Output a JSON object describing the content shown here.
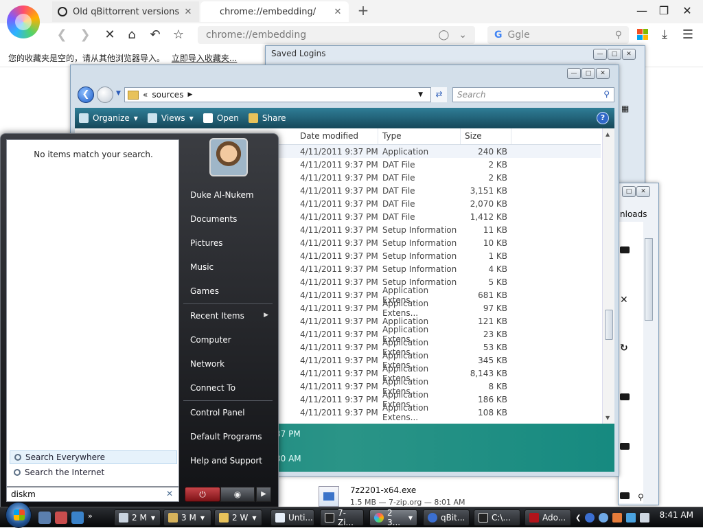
{
  "browser": {
    "tabs": [
      {
        "title": "Old qBittorrent versions down",
        "close": "✕"
      },
      {
        "title": "chrome://embedding/",
        "close": "✕"
      }
    ],
    "new_tab": "+",
    "address": "chrome://embedding",
    "search_engine": "G",
    "search_text": "Ggle",
    "bookmarks_message": "您的收藏夹是空的，请从其他浏览器导入。",
    "bookmarks_link": "立即导入收藏夹..."
  },
  "saved_logins": {
    "title": "Saved Logins"
  },
  "downloads": {
    "title_fragment": "nloads",
    "entry": {
      "name": "7z2201-x64.exe",
      "meta": "1.5 MB — 7-zip.org — 8:01 AM"
    }
  },
  "explorer": {
    "path": {
      "prefix": "«",
      "folder": "sources"
    },
    "search_placeholder": "Search",
    "commands": [
      "Organize",
      "Views",
      "Open",
      "Share"
    ],
    "columns": [
      "Date modified",
      "Type",
      "Size"
    ],
    "rows": [
      {
        "date": "4/11/2011 9:37 PM",
        "type": "Application",
        "size": "240 KB"
      },
      {
        "date": "4/11/2011 9:37 PM",
        "type": "DAT File",
        "size": "2 KB"
      },
      {
        "date": "4/11/2011 9:37 PM",
        "type": "DAT File",
        "size": "2 KB"
      },
      {
        "date": "4/11/2011 9:37 PM",
        "type": "DAT File",
        "size": "3,151 KB"
      },
      {
        "date": "4/11/2011 9:37 PM",
        "type": "DAT File",
        "size": "2,070 KB"
      },
      {
        "date": "4/11/2011 9:37 PM",
        "type": "DAT File",
        "size": "1,412 KB"
      },
      {
        "date": "4/11/2011 9:37 PM",
        "type": "Setup Information",
        "size": "11 KB"
      },
      {
        "date": "4/11/2011 9:37 PM",
        "type": "Setup Information",
        "size": "10 KB"
      },
      {
        "date": "4/11/2011 9:37 PM",
        "type": "Setup Information",
        "size": "1 KB"
      },
      {
        "date": "4/11/2011 9:37 PM",
        "type": "Setup Information",
        "size": "4 KB"
      },
      {
        "date": "4/11/2011 9:37 PM",
        "type": "Setup Information",
        "size": "5 KB"
      },
      {
        "date": "4/11/2011 9:37 PM",
        "type": "Application Extens...",
        "size": "681 KB"
      },
      {
        "date": "4/11/2011 9:37 PM",
        "type": "Application Extens...",
        "size": "97 KB"
      },
      {
        "date": "4/11/2011 9:37 PM",
        "type": "Application",
        "size": "121 KB"
      },
      {
        "date": "4/11/2011 9:37 PM",
        "type": "Application Extens...",
        "size": "23 KB"
      },
      {
        "date": "4/11/2011 9:37 PM",
        "type": "Application Extens...",
        "size": "53 KB"
      },
      {
        "date": "4/11/2011 9:37 PM",
        "type": "Application Extens...",
        "size": "345 KB"
      },
      {
        "date": "4/11/2011 9:37 PM",
        "type": "Application Extens...",
        "size": "8,143 KB"
      },
      {
        "date": "4/11/2011 9:37 PM",
        "type": "Application Extens...",
        "size": "8 KB"
      },
      {
        "date": "4/11/2011 9:37 PM",
        "type": "Application Extens...",
        "size": "186 KB"
      },
      {
        "date": "4/11/2011 9:37 PM",
        "type": "Application Extens...",
        "size": "108 KB"
      }
    ],
    "details": [
      "37 PM",
      "30 AM"
    ]
  },
  "start_menu": {
    "no_items": "No items match your search.",
    "search_everywhere": "Search Everywhere",
    "search_internet": "Search the Internet",
    "search_query": "diskm",
    "user": "Duke Al-Nukem",
    "links_top": [
      "Documents",
      "Pictures",
      "Music",
      "Games"
    ],
    "recent_items": "Recent Items",
    "links_mid": [
      "Computer",
      "Network",
      "Connect To"
    ],
    "links_bottom": [
      "Control Panel",
      "Default Programs",
      "Help and Support"
    ]
  },
  "taskbar": {
    "buttons": [
      "2 M",
      "3 M",
      "2 W",
      "Unti...",
      "7-Zi...",
      "2 3...",
      "qBit...",
      "C:\\...",
      "Ado..."
    ],
    "clock": "8:41 AM"
  },
  "colors": {
    "explorer_command_bar": "#16485a",
    "details_pane": "#168a80",
    "start_menu": "#111215",
    "taskbar": "#060708"
  }
}
